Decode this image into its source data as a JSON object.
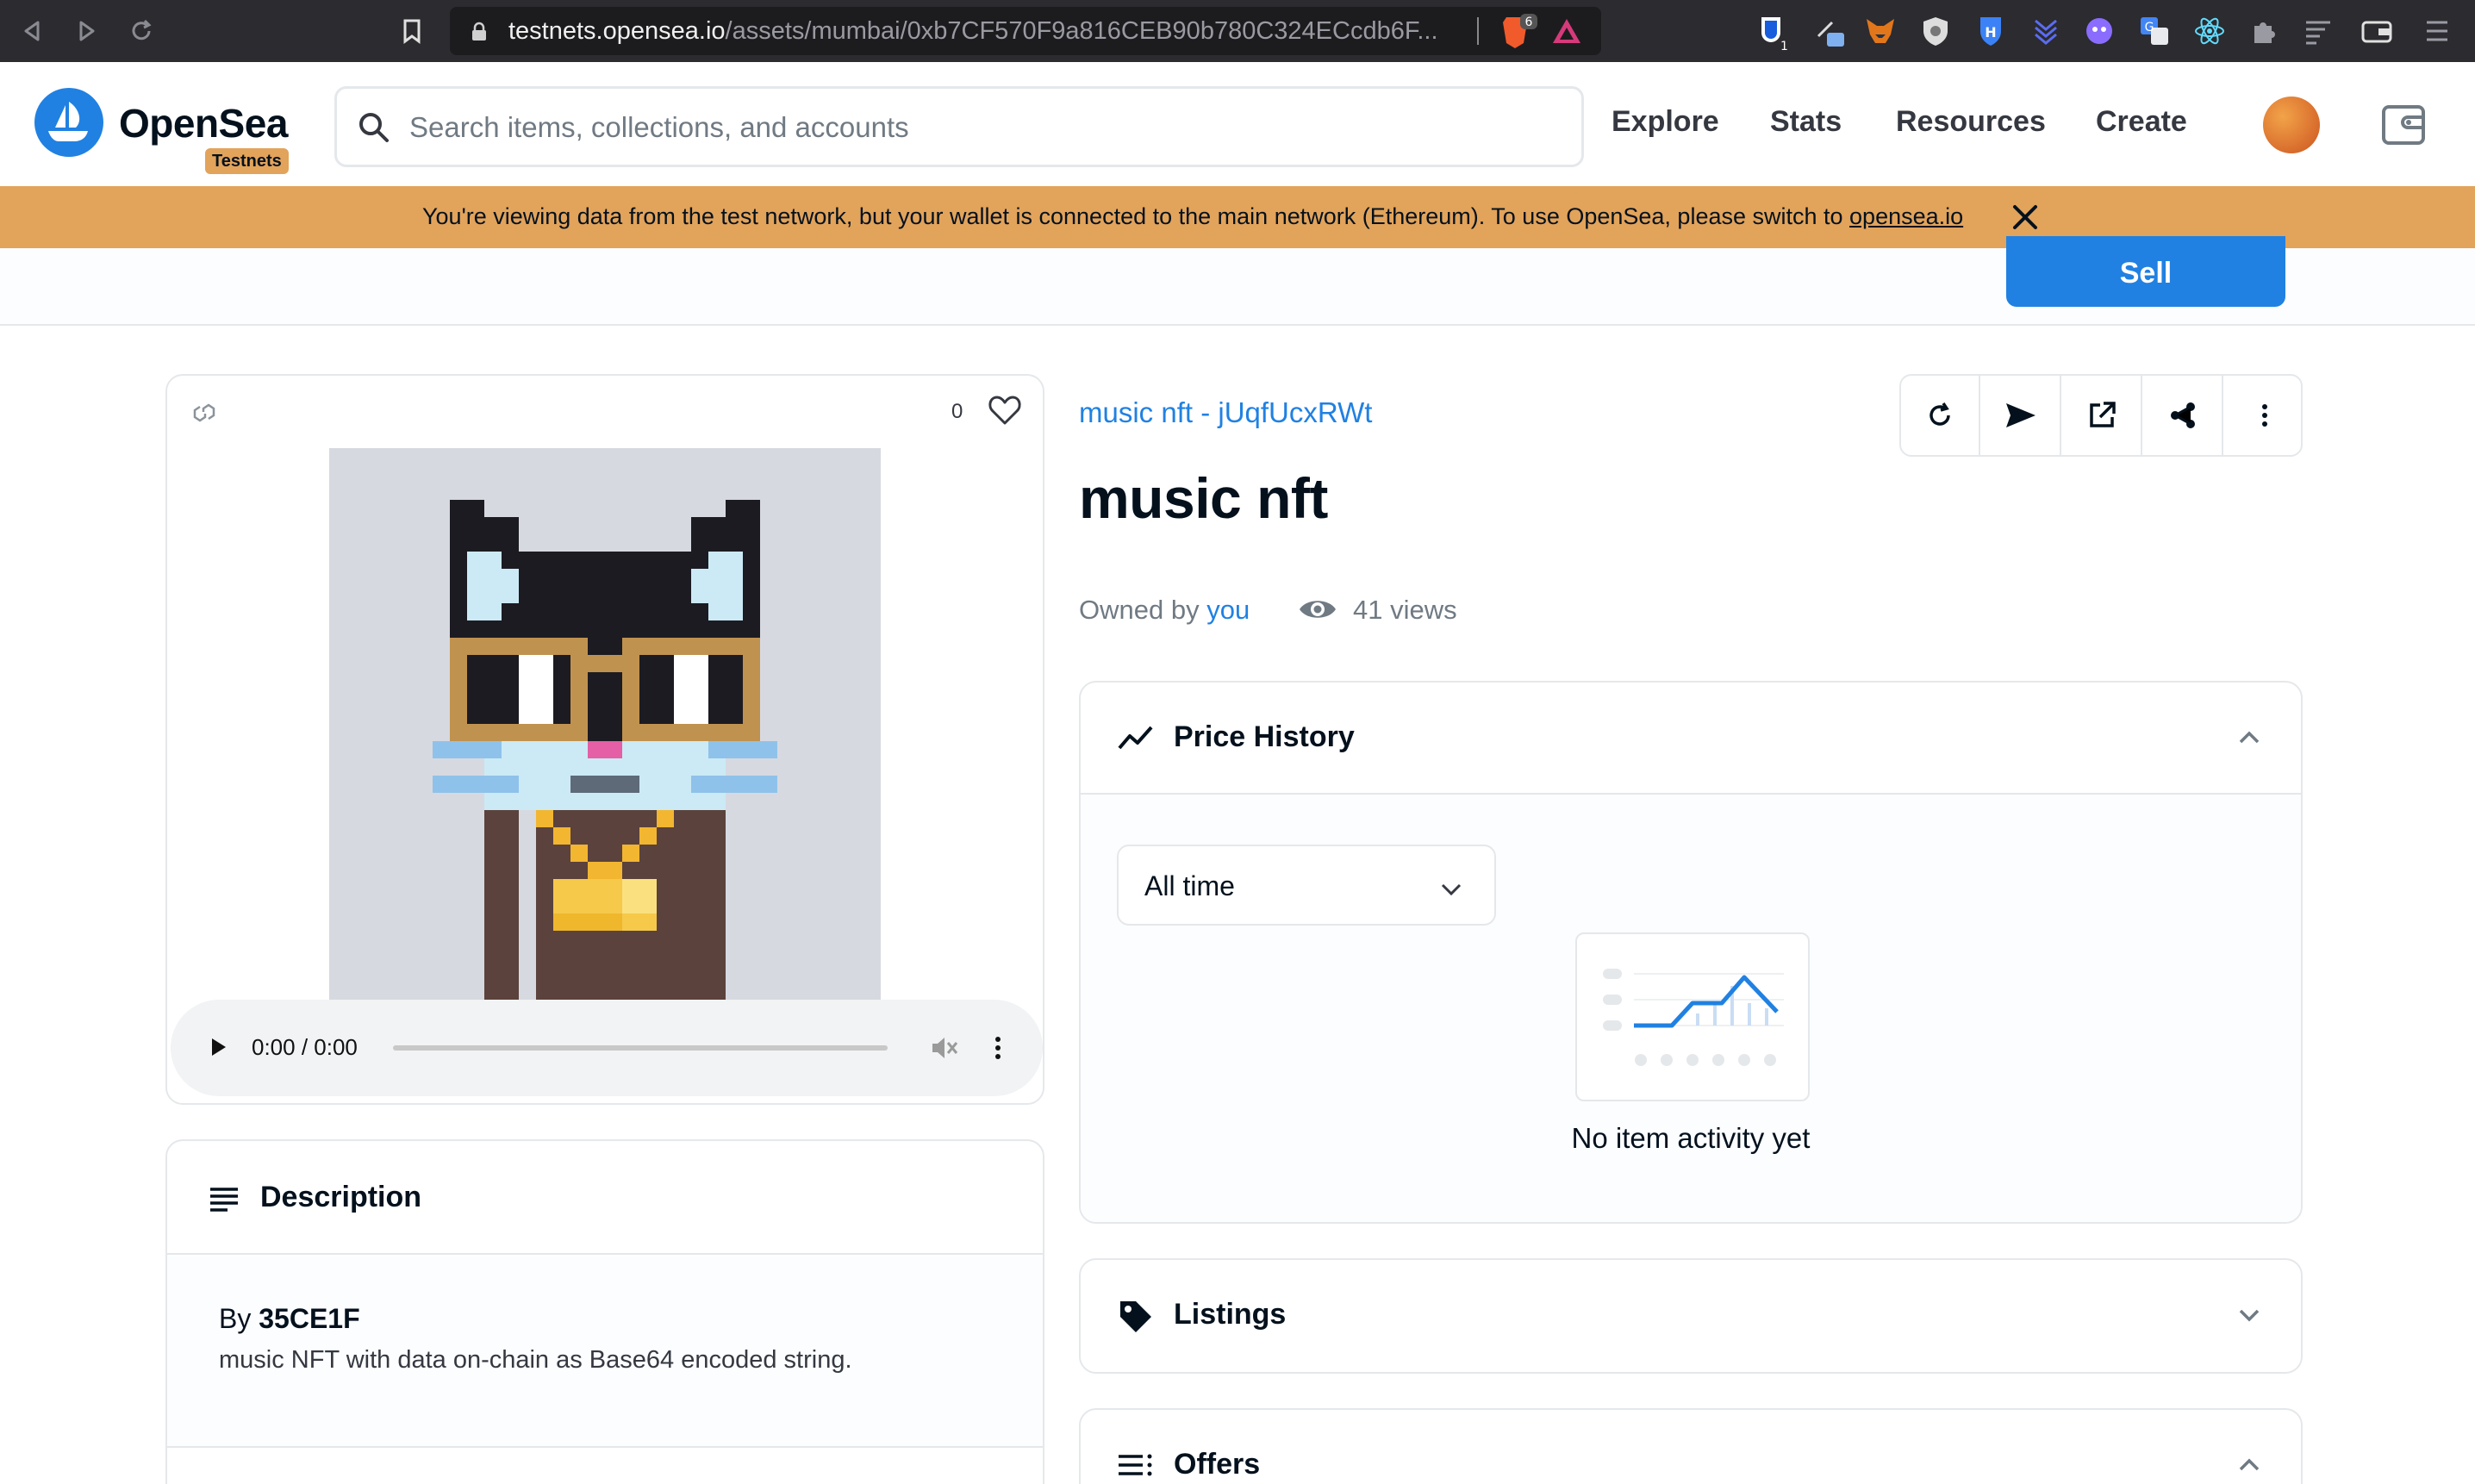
{
  "browser": {
    "url_host": "testnets.opensea.io",
    "url_path": "/assets/mumbai/0xb7CF570F9a816CEB90b780C324ECcdb6F...",
    "brave_badge": "6",
    "ext_badge": "1"
  },
  "header": {
    "logo_text": "OpenSea",
    "badge": "Testnets",
    "search_placeholder": "Search items, collections, and accounts",
    "nav": [
      "Explore",
      "Stats",
      "Resources",
      "Create"
    ]
  },
  "banner": {
    "message": "You're viewing data from the test network, but your wallet is connected to the main network (Ethereum). To use OpenSea, please switch to ",
    "link": "opensea.io"
  },
  "subbar": {
    "sell_label": "Sell"
  },
  "media": {
    "favorites": "0",
    "audio_time": "0:00 / 0:00"
  },
  "description": {
    "title": "Description",
    "by_prefix": "By",
    "creator": "35CE1F",
    "text": "music NFT with data on-chain as Base64 encoded string."
  },
  "item": {
    "collection": "music nft - jUqfUcxRWt",
    "title": "music nft",
    "owned_by": "Owned by",
    "owner": "you",
    "views": "41 views"
  },
  "panels": {
    "price_history": {
      "title": "Price History",
      "range": "All time",
      "empty": "No item activity yet"
    },
    "listings": {
      "title": "Listings"
    },
    "offers": {
      "title": "Offers"
    }
  },
  "colors": {
    "brand_blue": "#2081e2",
    "banner_orange": "#e2a35b",
    "text_dark": "#04111d",
    "text_gray": "#707a83"
  }
}
